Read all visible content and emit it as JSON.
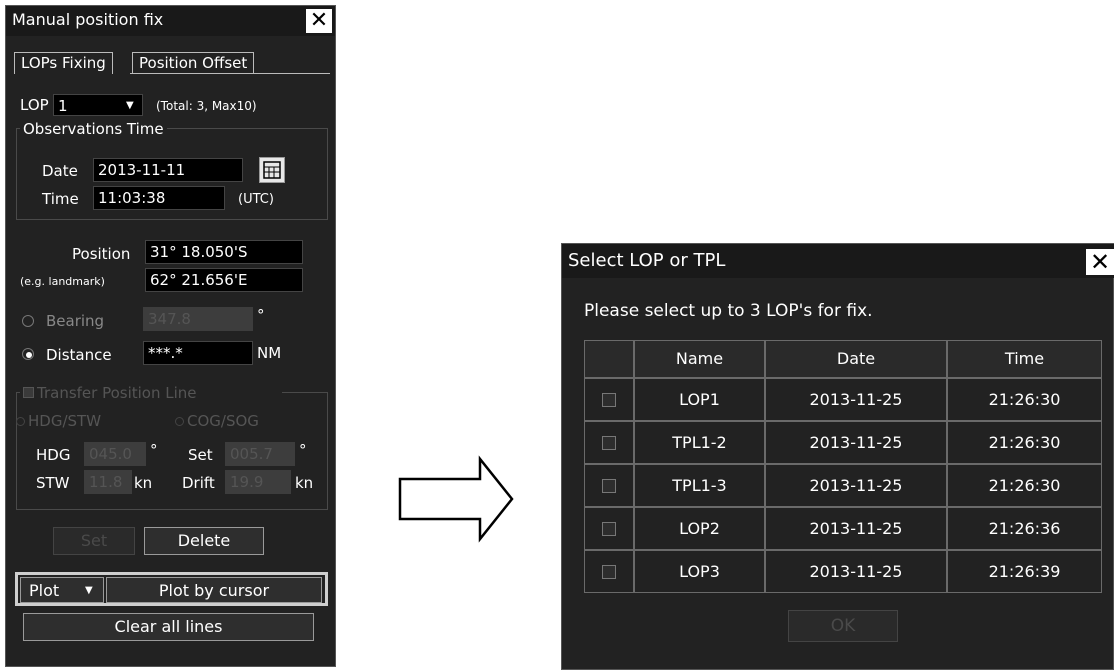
{
  "left_panel": {
    "title": "Manual position fix",
    "close_label": "✕",
    "tabs": [
      "LOPs Fixing",
      "Position Offset"
    ],
    "lop_label": "LOP",
    "lop_value": "1",
    "lop_total": "(Total: 3, Max10)",
    "obs_group": "Observations Time",
    "date_label": "Date",
    "date_value": "2013-11-11",
    "time_label": "Time",
    "time_value": "11:03:38",
    "utc_label": "(UTC)",
    "position_label": "Position",
    "lat_value": "31° 18.050'S",
    "landmark_label": "(e.g. landmark)",
    "lon_value": "62° 21.656'E",
    "bearing_label": "Bearing",
    "bearing_value": "347.8",
    "degree_unit": "°",
    "distance_label": "Distance",
    "distance_value": "***.*",
    "nm_unit": "NM",
    "transfer_group": "Transfer Position Line",
    "hdg_stw_label": "HDG/STW",
    "cog_sog_label": "COG/SOG",
    "hdg_label": "HDG",
    "hdg_value": "045.0",
    "set_label": "Set",
    "set_value": "005.7",
    "stw_label": "STW",
    "stw_value": "11.8",
    "kn_unit": "kn",
    "drift_label": "Drift",
    "drift_value": "19.9",
    "set_button": "Set",
    "delete_button": "Delete",
    "plot_select": "Plot",
    "plot_by_cursor": "Plot by cursor",
    "clear_all": "Clear all lines"
  },
  "dialog": {
    "title": "Select LOP or TPL",
    "close_label": "✕",
    "instruction": "Please select up to 3 LOP's for fix.",
    "columns": [
      "Name",
      "Date",
      "Time"
    ],
    "rows": [
      {
        "name": "LOP1",
        "date": "2013-11-25",
        "time": "21:26:30"
      },
      {
        "name": "TPL1-2",
        "date": "2013-11-25",
        "time": "21:26:30"
      },
      {
        "name": "TPL1-3",
        "date": "2013-11-25",
        "time": "21:26:30"
      },
      {
        "name": "LOP2",
        "date": "2013-11-25",
        "time": "21:26:36"
      },
      {
        "name": "LOP3",
        "date": "2013-11-25",
        "time": "21:26:39"
      }
    ],
    "ok_button": "OK"
  }
}
